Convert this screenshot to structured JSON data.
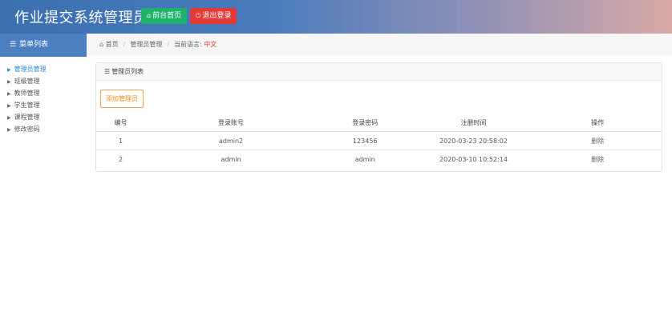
{
  "header": {
    "title": "作业提交系统管理员端",
    "home_button": "前台首页",
    "logout_button": "退出登录"
  },
  "sidebar": {
    "heading": "菜单列表",
    "items": [
      {
        "label": "管理员管理",
        "active": true
      },
      {
        "label": "班级管理",
        "active": false
      },
      {
        "label": "教师管理",
        "active": false
      },
      {
        "label": "学生管理",
        "active": false
      },
      {
        "label": "课程管理",
        "active": false
      },
      {
        "label": "修改密码",
        "active": false
      }
    ]
  },
  "breadcrumb": {
    "home": "首页",
    "current": "管理员管理",
    "lang_label": "当前语言:",
    "lang_value": "中文"
  },
  "panel": {
    "title": "管理员列表",
    "add_button": "添加管理员"
  },
  "table": {
    "columns": [
      "编号",
      "登录账号",
      "登录密码",
      "注册时间",
      "操作"
    ],
    "rows": [
      {
        "id": "1",
        "account": "admin2",
        "password": "123456",
        "registered": "2020-03-23 20:58:02",
        "action": "删除"
      },
      {
        "id": "2",
        "account": "admin",
        "password": "admin",
        "registered": "2020-03-10 10:52:14",
        "action": "删除"
      }
    ]
  },
  "colors": {
    "sidebar_header": "#4b7fc0",
    "home_button": "#20b26a",
    "logout_button": "#e53935",
    "add_button": "#f08a1c",
    "active_item": "#2e8ad8"
  }
}
